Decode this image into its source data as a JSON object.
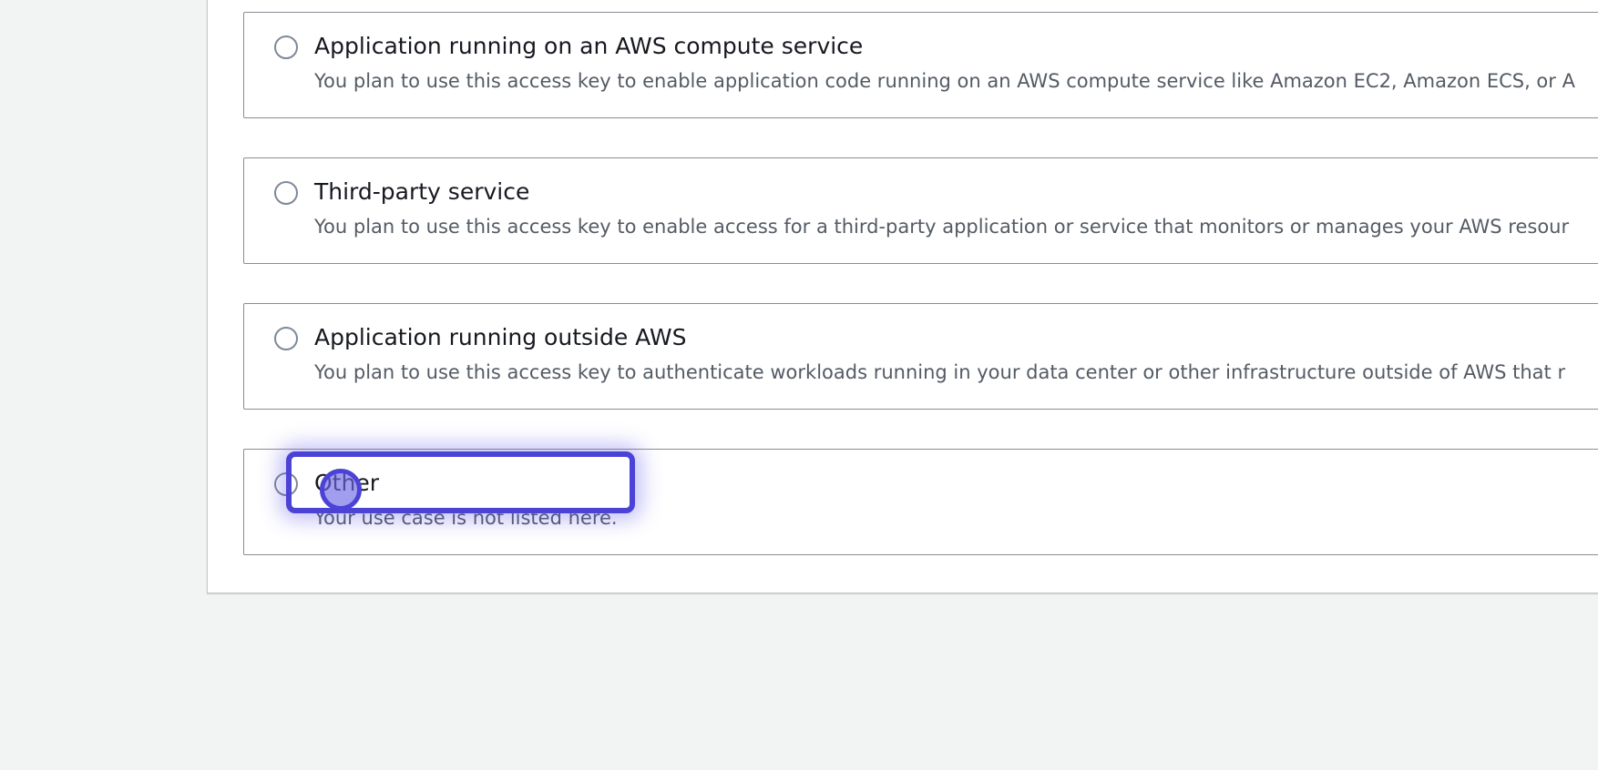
{
  "options": [
    {
      "label": "Application running on an AWS compute service",
      "description": "You plan to use this access key to enable application code running on an AWS compute service like Amazon EC2, Amazon ECS, or A"
    },
    {
      "label": "Third-party service",
      "description": "You plan to use this access key to enable access for a third-party application or service that monitors or manages your AWS resour"
    },
    {
      "label": "Application running outside AWS",
      "description": "You plan to use this access key to authenticate workloads running in your data center or other infrastructure outside of AWS that r"
    },
    {
      "label": "Other",
      "description": "Your use case is not listed here."
    }
  ],
  "colors": {
    "page_background": "#f2f3f3",
    "panel_background": "#ffffff",
    "tile_border": "#8c8c94",
    "label_text": "#16191f",
    "description_text": "#545b64",
    "highlight": "#4b42d6"
  },
  "icons": {
    "radio": "radio-unchecked-icon",
    "cursor": "click-indicator-icon"
  }
}
